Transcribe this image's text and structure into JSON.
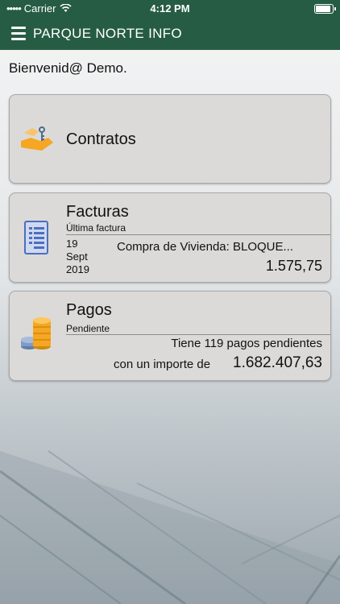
{
  "status": {
    "carrier": "Carrier",
    "time": "4:12 PM",
    "battery_level": 1.0
  },
  "navbar": {
    "title": "PARQUE NORTE INFO",
    "menu_icon": "hamburger-icon"
  },
  "welcome": "Bienvenid@ Demo.",
  "cards": {
    "contratos": {
      "title": "Contratos",
      "icon": "handshake-keys-icon"
    },
    "facturas": {
      "title": "Facturas",
      "subtitle": "Última factura",
      "day": "19",
      "month": "Sept",
      "year": "2019",
      "concept": "Compra de Vivienda: BLOQUE...",
      "amount": "1.575,75",
      "icon": "invoice-document-icon"
    },
    "pagos": {
      "title": "Pagos",
      "subtitle": "Pendiente",
      "line1": "Tiene 119 pagos pendientes",
      "line2_prefix": "con un importe de",
      "amount": "1.682.407,63",
      "icon": "coins-stack-icon"
    }
  },
  "colors": {
    "brand": "#275c44",
    "card": "#dcdad8",
    "background": "#f1f2f2"
  }
}
